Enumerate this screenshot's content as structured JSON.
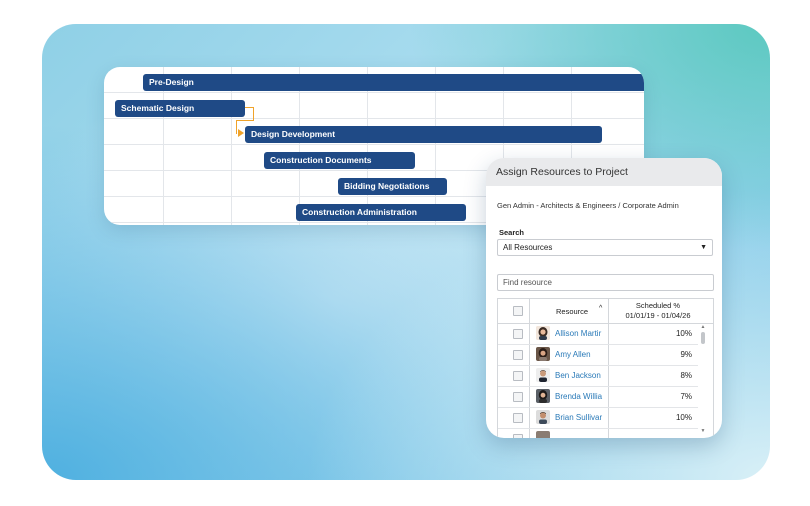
{
  "gantt": {
    "tasks": [
      {
        "label": "Pre-Design"
      },
      {
        "label": "Schematic Design"
      },
      {
        "label": "Design Development"
      },
      {
        "label": "Construction Documents"
      },
      {
        "label": "Bidding Negotiations"
      },
      {
        "label": "Construction Administration"
      }
    ],
    "colors": {
      "bar": "#1f4a86",
      "dependency": "#f0a32a"
    }
  },
  "dialog": {
    "title": "Assign Resources to Project",
    "breadcrumb": "Gen Admin - Architects & Engineers / Corporate Admin",
    "search_label": "Search",
    "search_select_value": "All Resources",
    "find_placeholder": "Find resource",
    "table": {
      "col_resource": "Resource",
      "col_scheduled_line1": "Scheduled %",
      "col_scheduled_line2": "01/01/19 - 01/04/26",
      "rows": [
        {
          "name": "Allison Martir",
          "pct": "10%",
          "avatar": "woman-avatar"
        },
        {
          "name": "Amy Allen",
          "pct": "9%",
          "avatar": "woman-avatar"
        },
        {
          "name": "Ben Jackson",
          "pct": "8%",
          "avatar": "man-avatar"
        },
        {
          "name": "Brenda Willia",
          "pct": "7%",
          "avatar": "woman-avatar"
        },
        {
          "name": "Brian Sullivar",
          "pct": "10%",
          "avatar": "man-avatar"
        }
      ]
    }
  }
}
